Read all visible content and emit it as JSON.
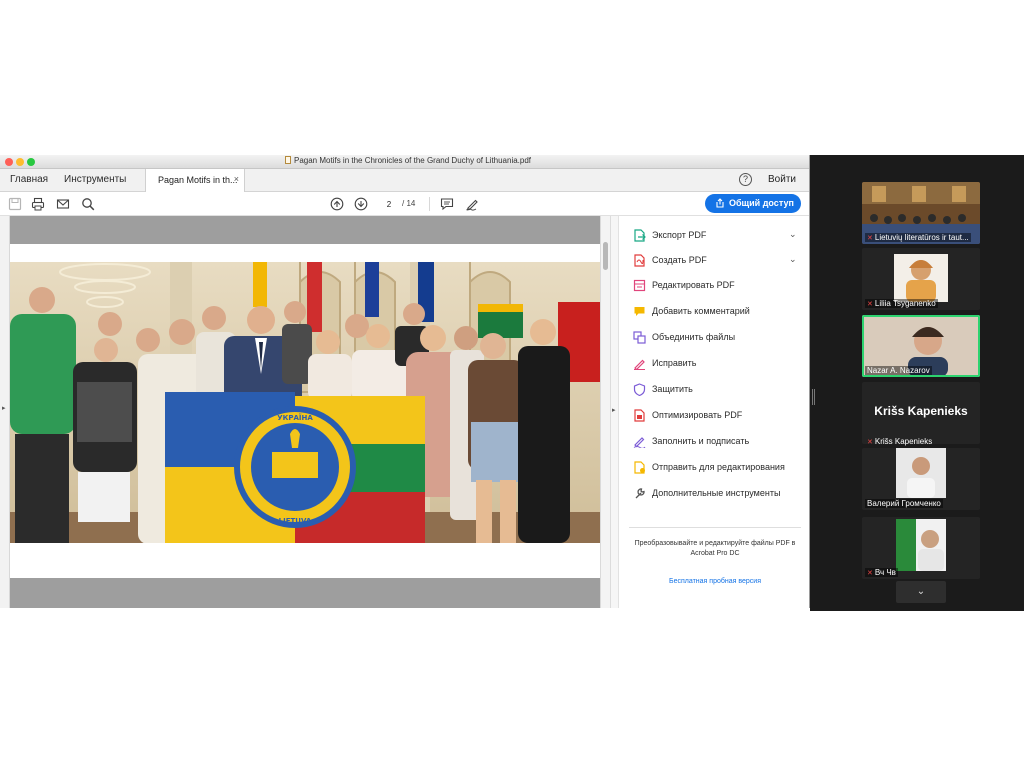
{
  "window": {
    "title": "Pagan Motifs in the Chronicles of the Grand Duchy of Lithuania.pdf"
  },
  "tabs": {
    "home": "Главная",
    "tools": "Инструменты",
    "document": "Pagan Motifs in th...",
    "close": "×",
    "help": "?",
    "sign_in": "Войти"
  },
  "toolbar": {
    "page_current": "2",
    "page_total": "/ 14",
    "share_label": "Общий доступ"
  },
  "photo": {
    "flag_seal_top": "УКРАЇНА",
    "flag_seal_bottom": "LIETUVA"
  },
  "tools_pane": {
    "items": [
      {
        "label": "Экспорт PDF",
        "icon": "export-pdf-icon",
        "color": "#17a884",
        "expandable": true
      },
      {
        "label": "Создать PDF",
        "icon": "create-pdf-icon",
        "color": "#e13c3c",
        "expandable": true
      },
      {
        "label": "Редактировать PDF",
        "icon": "edit-pdf-icon",
        "color": "#e0457b",
        "expandable": false
      },
      {
        "label": "Добавить комментарий",
        "icon": "comment-icon",
        "color": "#f5b800",
        "expandable": false
      },
      {
        "label": "Объединить файлы",
        "icon": "combine-files-icon",
        "color": "#7c5cd6",
        "expandable": false
      },
      {
        "label": "Исправить",
        "icon": "redact-icon",
        "color": "#e0457b",
        "expandable": false
      },
      {
        "label": "Защитить",
        "icon": "protect-icon",
        "color": "#7c5cd6",
        "expandable": false
      },
      {
        "label": "Оптимизировать PDF",
        "icon": "optimize-pdf-icon",
        "color": "#e13c3c",
        "expandable": false
      },
      {
        "label": "Заполнить и подписать",
        "icon": "fill-sign-icon",
        "color": "#7c5cd6",
        "expandable": false
      },
      {
        "label": "Отправить для редактирования",
        "icon": "send-review-icon",
        "color": "#f5b800",
        "expandable": false
      },
      {
        "label": "Дополнительные инструменты",
        "icon": "more-tools-icon",
        "color": "#555555",
        "expandable": false
      }
    ],
    "promo": "Преобразовывайте и редактируйте файлы PDF в Acrobat Pro DC",
    "trial": "Бесплатная пробная версия"
  },
  "zoom": {
    "participants": [
      {
        "name": "Lietuvių literatūros ir taut...",
        "muted": true
      },
      {
        "name": "Liliia Tsyganenko",
        "muted": true
      },
      {
        "name": "Nazar A. Nazarov",
        "muted": false,
        "active": true
      },
      {
        "name": "Krišs Kapenieks",
        "muted": true,
        "video_off": true
      },
      {
        "name": "Валерий Громченко",
        "muted": false
      },
      {
        "name": "Вч Чв",
        "muted": true
      }
    ],
    "video_off_big_name": "Krišs Kapenieks",
    "more": "⌄"
  },
  "colors": {
    "accent": "#1473e6",
    "active_speaker": "#2dd36f",
    "zoom_bg": "#1b1b1b"
  }
}
